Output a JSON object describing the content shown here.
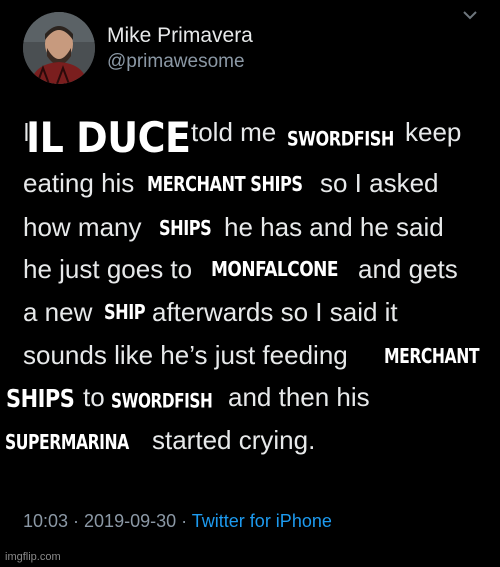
{
  "tweet": {
    "author": {
      "display_name": "Mike Primavera",
      "handle": "@primawesome"
    },
    "text_lines": [
      "I",
      "told me",
      "keep",
      "eating his",
      "so I asked",
      "how many",
      "he has and he said",
      "he just goes to",
      "and gets",
      "a new",
      "afterwards so I said it",
      "sounds like he’s just feeding",
      "to",
      "and then his",
      "started crying."
    ],
    "timestamp": "10:03 · 2019-09-30 ·",
    "source_app": "Twitter for iPhone"
  },
  "meme_overlays": [
    "IL DUCE",
    "SWORDFISH",
    "MERCHANT SHIPS",
    "SHIPS",
    "MONFALCONE",
    "SHIP",
    "MERCHANT",
    "SHIPS",
    "SWORDFISH",
    "SUPERMARINA"
  ],
  "watermark": "imgflip.com",
  "colors": {
    "background": "#000000",
    "text": "#e7e9ea",
    "secondary": "#8b98a5",
    "link": "#1d9bf0"
  }
}
